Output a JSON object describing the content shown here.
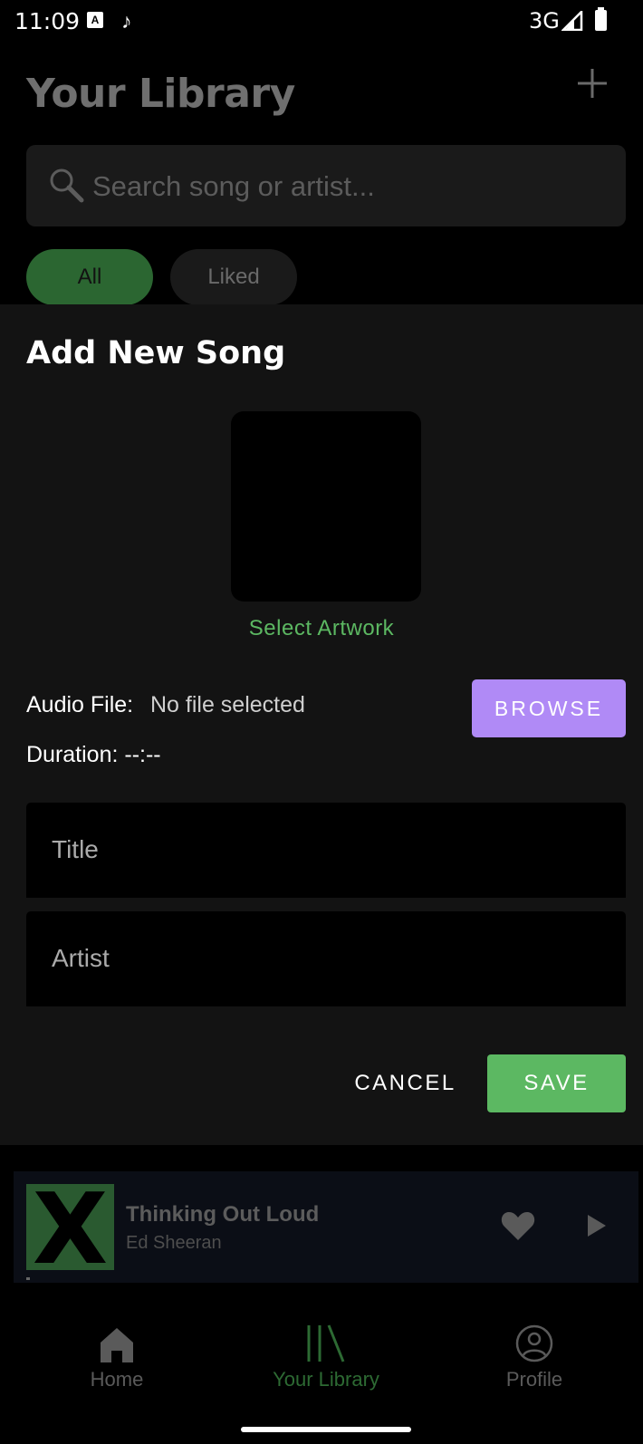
{
  "status_bar": {
    "time": "11:09",
    "notification_icons": [
      "a-badge-icon",
      "music-note-icon"
    ],
    "network": "3G",
    "signal_icon": "signal-icon",
    "battery_icon": "battery-icon"
  },
  "header": {
    "title": "Your Library",
    "add_icon": "plus-icon"
  },
  "search": {
    "placeholder": "Search song or artist..."
  },
  "filters": {
    "all": "All",
    "liked": "Liked",
    "selected": "All"
  },
  "dialog": {
    "title": "Add New Song",
    "select_artwork": "Select Artwork",
    "audio_file_label": "Audio File:",
    "audio_file_value": "No file selected",
    "browse": "BROWSE",
    "duration_label": "Duration: --:--",
    "title_placeholder": "Title",
    "artist_placeholder": "Artist",
    "cancel": "CANCEL",
    "save": "SAVE"
  },
  "player": {
    "song": "Thinking Out Loud",
    "artist": "Ed Sheeran",
    "artwork_letter": "X",
    "liked": true,
    "progress": 0.01
  },
  "bottom_nav": {
    "items": [
      {
        "label": "Home",
        "icon": "home-icon",
        "active": false
      },
      {
        "label": "Your Library",
        "icon": "library-icon",
        "active": true
      },
      {
        "label": "Profile",
        "icon": "profile-icon",
        "active": false
      }
    ]
  },
  "colors": {
    "accent_green": "#5cb862",
    "browse_purple": "#b08af6",
    "sheet_bg": "#131313"
  }
}
